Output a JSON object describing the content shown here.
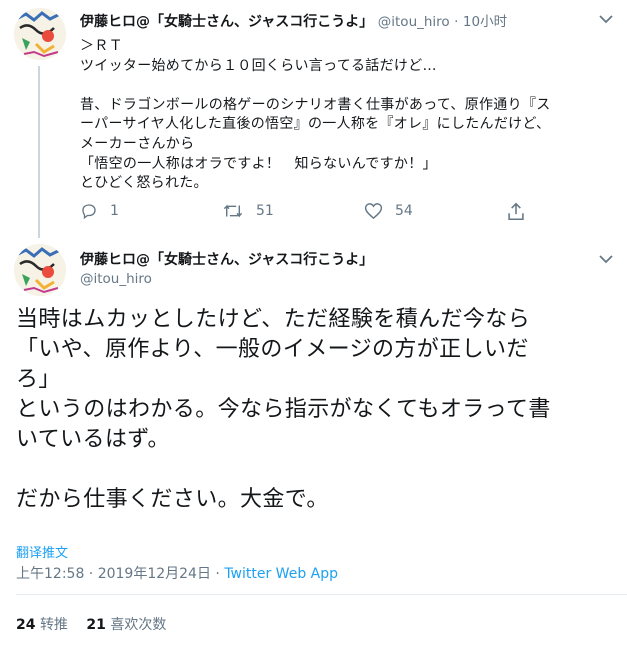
{
  "tweet1": {
    "name": "伊藤ヒロ@「女騎士さん、ジャスコ行こうよ」",
    "handle": "@itou_hiro",
    "separator": "·",
    "time": "10小时",
    "lines": [
      "＞ＲＴ",
      "ツイッター始めてから１０回くらい言ってる話だけど…",
      "",
      "昔、ドラゴンボールの格ゲーのシナリオ書く仕事があって、原作通り『ス",
      "ーパーサイヤ人化した直後の悟空』の一人称を『オレ』にしたんだけど、",
      "メーカーさんから",
      "「悟空の一人称はオラですよ！　知らないんですか！」",
      "とひどく怒られた。"
    ],
    "actions": {
      "reply_count": "1",
      "retweet_count": "51",
      "like_count": "54"
    }
  },
  "tweet2": {
    "name": "伊藤ヒロ@「女騎士さん、ジャスコ行こうよ」",
    "handle": "@itou_hiro",
    "lines": [
      "当時はムカッとしたけど、ただ経験を積んだ今なら",
      "「いや、原作より、一般のイメージの方が正しいだ",
      "ろ」",
      "というのはわかる。今なら指示がなくてもオラって書",
      "いているはず。",
      "",
      "だから仕事ください。大金で。"
    ],
    "translate_label": "翻译推文",
    "timestamp": "上午12:58 · 2019年12月24日 · ",
    "source": "Twitter Web App",
    "stats": {
      "retweets": "24",
      "retweets_label": "转推",
      "likes": "21",
      "likes_label": "喜欢次数"
    }
  },
  "colors": {
    "text": "#14171a",
    "secondary": "#657786",
    "accent": "#1da1f2",
    "divider": "#e6ecf0"
  }
}
